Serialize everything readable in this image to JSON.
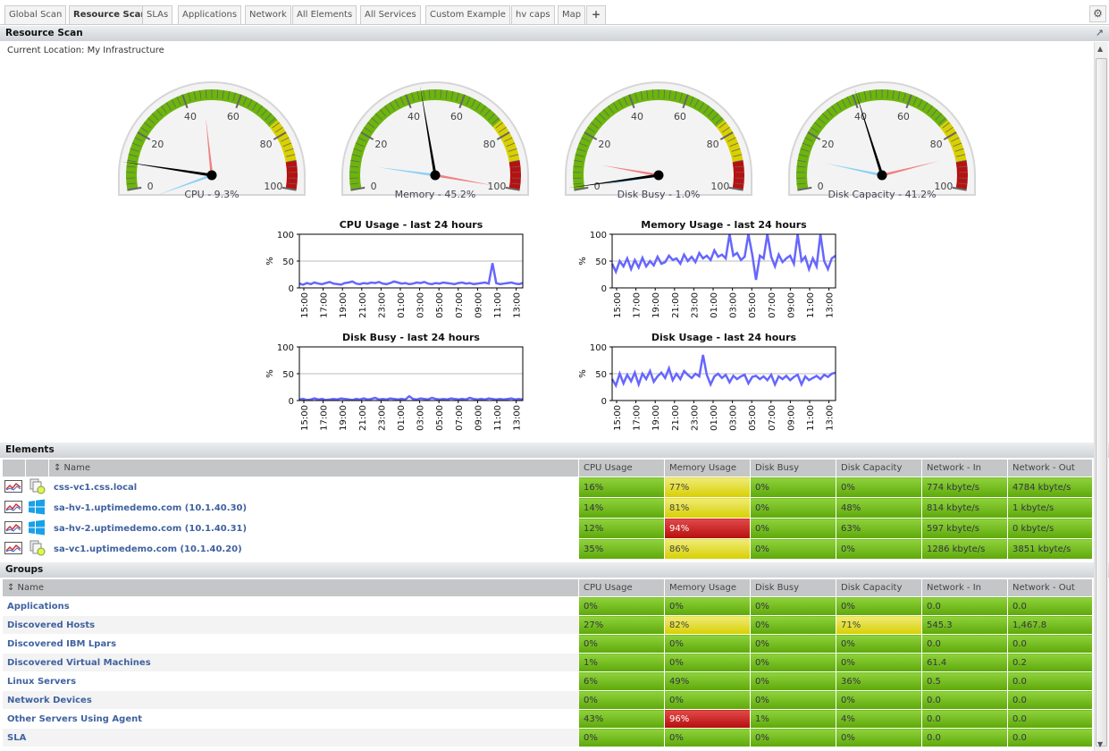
{
  "tabs": [
    {
      "label": "Global Scan"
    },
    {
      "label": "Resource Scan",
      "active": true
    },
    {
      "label": "SLAs"
    },
    {
      "label": "Applications"
    },
    {
      "label": "Network"
    },
    {
      "label": "All Elements"
    },
    {
      "label": "All Services"
    },
    {
      "label": "Custom Example"
    },
    {
      "label": "hv caps"
    },
    {
      "label": "Map"
    },
    {
      "label": "+"
    }
  ],
  "panel": {
    "title": "Resource Scan",
    "location": "Current Location: My Infrastructure",
    "popout_icon": "↗",
    "settings_icon": "⚙"
  },
  "gauge_ticks": [
    "0",
    "20",
    "40",
    "60",
    "80",
    "100"
  ],
  "gauges": [
    {
      "label": "CPU - 9.3%",
      "value": 9.3,
      "max": 47,
      "min": -5
    },
    {
      "label": "Memory - 45.2%",
      "value": 45.2,
      "max": 100,
      "min": 9
    },
    {
      "label": "Disk Busy - 1.0%",
      "value": 1.0,
      "max": 10,
      "min": 0
    },
    {
      "label": "Disk Capacity - 41.2%",
      "value": 41.2,
      "max": 88,
      "min": 11
    }
  ],
  "colors": {
    "green": "#6cb50c",
    "yellow": "#d8d000",
    "red": "#b81010",
    "line": "#6666ff"
  },
  "chart_data": [
    {
      "type": "line",
      "title": "CPU Usage - last 24 hours",
      "ylabel": "%",
      "ylim": [
        0,
        100
      ],
      "yticks": [
        "0",
        "50",
        "100"
      ],
      "xticks": [
        "15:00",
        "17:00",
        "19:00",
        "21:00",
        "23:00",
        "01:00",
        "03:00",
        "05:00",
        "07:00",
        "09:00",
        "11:00",
        "13:00"
      ],
      "values": [
        8,
        6,
        9,
        7,
        10,
        8,
        7,
        9,
        11,
        8,
        7,
        6,
        9,
        10,
        12,
        8,
        7,
        9,
        8,
        10,
        9,
        11,
        8,
        7,
        9,
        12,
        10,
        8,
        9,
        7,
        8,
        10,
        9,
        11,
        8,
        7,
        9,
        8,
        10,
        9,
        8,
        7,
        9,
        10,
        8,
        9,
        7,
        8,
        9,
        10,
        8,
        46,
        9,
        7,
        8,
        9,
        10,
        8,
        7,
        9
      ]
    },
    {
      "type": "line",
      "title": "Memory Usage - last 24 hours",
      "ylabel": "%",
      "ylim": [
        0,
        100
      ],
      "yticks": [
        "0",
        "50",
        "100"
      ],
      "xticks": [
        "15:00",
        "17:00",
        "19:00",
        "21:00",
        "23:00",
        "01:00",
        "03:00",
        "05:00",
        "07:00",
        "09:00",
        "11:00",
        "13:00"
      ],
      "values": [
        45,
        30,
        50,
        40,
        55,
        35,
        52,
        38,
        56,
        40,
        50,
        42,
        58,
        45,
        48,
        60,
        52,
        55,
        45,
        62,
        50,
        58,
        48,
        65,
        55,
        60,
        52,
        70,
        58,
        62,
        55,
        100,
        60,
        65,
        52,
        58,
        100,
        62,
        15,
        60,
        55,
        100,
        58,
        40,
        62,
        48,
        55,
        60,
        45,
        100,
        50,
        58,
        35,
        55,
        40,
        100,
        50,
        35,
        55,
        60
      ]
    },
    {
      "type": "line",
      "title": "Disk Busy - last 24 hours",
      "ylabel": "%",
      "ylim": [
        0,
        100
      ],
      "yticks": [
        "0",
        "50",
        "100"
      ],
      "xticks": [
        "15:00",
        "17:00",
        "19:00",
        "21:00",
        "23:00",
        "01:00",
        "03:00",
        "05:00",
        "07:00",
        "09:00",
        "11:00",
        "13:00"
      ],
      "values": [
        2,
        3,
        1,
        2,
        4,
        2,
        3,
        1,
        2,
        3,
        2,
        4,
        3,
        2,
        1,
        3,
        2,
        4,
        2,
        3,
        5,
        2,
        3,
        2,
        4,
        3,
        2,
        3,
        2,
        8,
        3,
        2,
        4,
        3,
        2,
        5,
        3,
        2,
        3,
        2,
        4,
        3,
        2,
        3,
        2,
        5,
        3,
        2,
        3,
        2,
        4,
        3,
        2,
        3,
        2,
        3,
        4,
        2,
        3,
        2
      ]
    },
    {
      "type": "line",
      "title": "Disk Usage - last 24 hours",
      "ylabel": "%",
      "ylim": [
        0,
        100
      ],
      "yticks": [
        "0",
        "50",
        "100"
      ],
      "xticks": [
        "15:00",
        "17:00",
        "19:00",
        "21:00",
        "23:00",
        "01:00",
        "03:00",
        "05:00",
        "07:00",
        "09:00",
        "11:00",
        "13:00"
      ],
      "values": [
        40,
        28,
        50,
        32,
        48,
        36,
        52,
        30,
        50,
        40,
        55,
        35,
        45,
        52,
        42,
        60,
        38,
        50,
        40,
        55,
        48,
        42,
        50,
        45,
        85,
        48,
        30,
        45,
        50,
        42,
        48,
        34,
        46,
        40,
        45,
        48,
        32,
        44,
        46,
        40,
        45,
        38,
        48,
        30,
        45,
        40,
        46,
        38,
        44,
        48,
        30,
        45,
        38,
        42,
        46,
        40,
        48,
        44,
        50,
        52
      ]
    }
  ],
  "elements": {
    "title": "Elements",
    "columns": [
      "↕ Name",
      "CPU Usage",
      "Memory Usage",
      "Disk Busy",
      "Disk Capacity",
      "Network - In",
      "Network - Out"
    ],
    "rows": [
      {
        "icon": "vcenter",
        "name": "css-vc1.css.local",
        "cells": [
          [
            "16%",
            "green"
          ],
          [
            "77%",
            "yellow"
          ],
          [
            "0%",
            "green"
          ],
          [
            "0%",
            "green"
          ],
          [
            "774 kbyte/s",
            "green"
          ],
          [
            "4784 kbyte/s",
            "green"
          ]
        ]
      },
      {
        "icon": "windows",
        "name": "sa-hv-1.uptimedemo.com (10.1.40.30)",
        "cells": [
          [
            "14%",
            "green"
          ],
          [
            "81%",
            "yellow"
          ],
          [
            "0%",
            "green"
          ],
          [
            "48%",
            "green"
          ],
          [
            "814 kbyte/s",
            "green"
          ],
          [
            "1 kbyte/s",
            "green"
          ]
        ]
      },
      {
        "icon": "windows",
        "name": "sa-hv-2.uptimedemo.com (10.1.40.31)",
        "cells": [
          [
            "12%",
            "green"
          ],
          [
            "94%",
            "red"
          ],
          [
            "0%",
            "green"
          ],
          [
            "63%",
            "green"
          ],
          [
            "597 kbyte/s",
            "green"
          ],
          [
            "0 kbyte/s",
            "green"
          ]
        ]
      },
      {
        "icon": "vcenter",
        "name": "sa-vc1.uptimedemo.com (10.1.40.20)",
        "cells": [
          [
            "35%",
            "green"
          ],
          [
            "86%",
            "yellow"
          ],
          [
            "0%",
            "green"
          ],
          [
            "0%",
            "green"
          ],
          [
            "1286 kbyte/s",
            "green"
          ],
          [
            "3851 kbyte/s",
            "green"
          ]
        ]
      }
    ]
  },
  "groups": {
    "title": "Groups",
    "columns": [
      "↕ Name",
      "CPU Usage",
      "Memory Usage",
      "Disk Busy",
      "Disk Capacity",
      "Network - In",
      "Network - Out"
    ],
    "rows": [
      {
        "name": "Applications",
        "cells": [
          [
            "0%",
            "green"
          ],
          [
            "0%",
            "green"
          ],
          [
            "0%",
            "green"
          ],
          [
            "0%",
            "green"
          ],
          [
            "0.0",
            "green"
          ],
          [
            "0.0",
            "green"
          ]
        ]
      },
      {
        "name": "Discovered Hosts",
        "cells": [
          [
            "27%",
            "green"
          ],
          [
            "82%",
            "yellow"
          ],
          [
            "0%",
            "green"
          ],
          [
            "71%",
            "yellow"
          ],
          [
            "545.3",
            "green"
          ],
          [
            "1,467.8",
            "green"
          ]
        ]
      },
      {
        "name": "Discovered IBM Lpars",
        "cells": [
          [
            "0%",
            "green"
          ],
          [
            "0%",
            "green"
          ],
          [
            "0%",
            "green"
          ],
          [
            "0%",
            "green"
          ],
          [
            "0.0",
            "green"
          ],
          [
            "0.0",
            "green"
          ]
        ]
      },
      {
        "name": "Discovered Virtual Machines",
        "cells": [
          [
            "1%",
            "green"
          ],
          [
            "0%",
            "green"
          ],
          [
            "0%",
            "green"
          ],
          [
            "0%",
            "green"
          ],
          [
            "61.4",
            "green"
          ],
          [
            "0.2",
            "green"
          ]
        ]
      },
      {
        "name": "Linux Servers",
        "cells": [
          [
            "6%",
            "green"
          ],
          [
            "49%",
            "green"
          ],
          [
            "0%",
            "green"
          ],
          [
            "36%",
            "green"
          ],
          [
            "0.5",
            "green"
          ],
          [
            "0.0",
            "green"
          ]
        ]
      },
      {
        "name": "Network Devices",
        "cells": [
          [
            "0%",
            "green"
          ],
          [
            "0%",
            "green"
          ],
          [
            "0%",
            "green"
          ],
          [
            "0%",
            "green"
          ],
          [
            "0.0",
            "green"
          ],
          [
            "0.0",
            "green"
          ]
        ]
      },
      {
        "name": "Other Servers Using Agent",
        "cells": [
          [
            "43%",
            "green"
          ],
          [
            "96%",
            "red"
          ],
          [
            "1%",
            "green"
          ],
          [
            "4%",
            "green"
          ],
          [
            "0.0",
            "green"
          ],
          [
            "0.0",
            "green"
          ]
        ]
      },
      {
        "name": "SLA",
        "cells": [
          [
            "0%",
            "green"
          ],
          [
            "0%",
            "green"
          ],
          [
            "0%",
            "green"
          ],
          [
            "0%",
            "green"
          ],
          [
            "0.0",
            "green"
          ],
          [
            "0.0",
            "green"
          ]
        ]
      }
    ]
  }
}
